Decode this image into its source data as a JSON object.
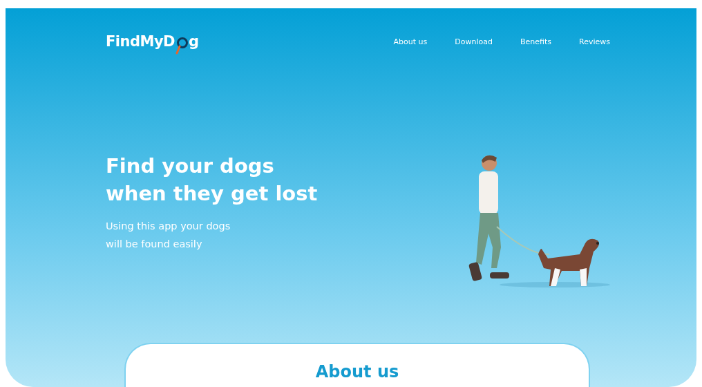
{
  "logo": {
    "text_before": "FindMyD",
    "text_after": "g"
  },
  "nav": [
    {
      "label": "About us"
    },
    {
      "label": "Download"
    },
    {
      "label": "Benefits"
    },
    {
      "label": "Reviews"
    }
  ],
  "hero": {
    "title_lines": [
      "Find your dogs",
      "when they get lost"
    ],
    "subtitle_lines": [
      "Using this app your dogs",
      "will be found easily"
    ]
  },
  "about": {
    "title": "About us"
  }
}
